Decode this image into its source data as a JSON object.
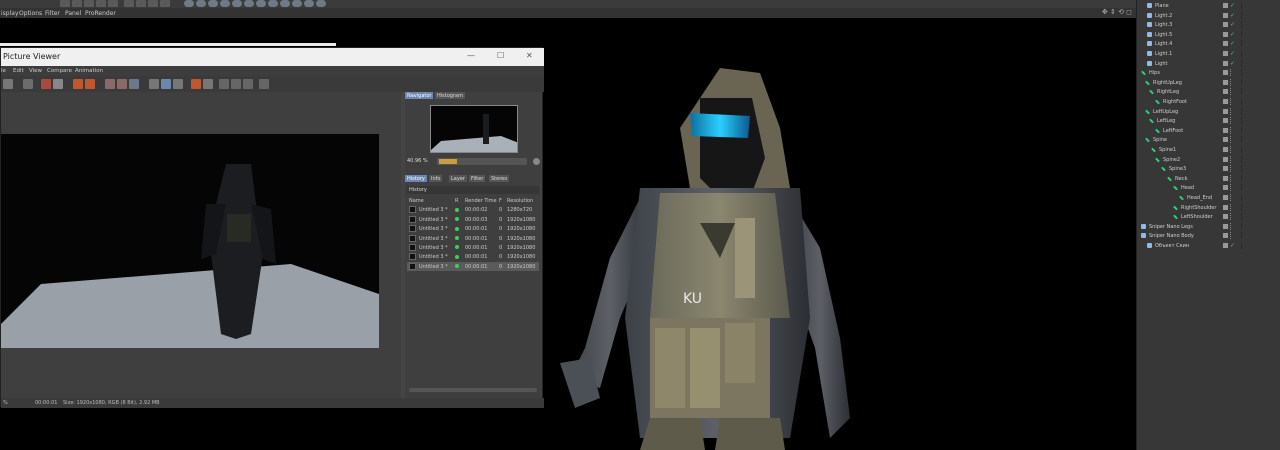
{
  "menu": {
    "items": [
      "isplay",
      "Options",
      "Filter",
      "Panel",
      "ProRender"
    ]
  },
  "picture_viewer": {
    "title": "Picture Viewer",
    "window_buttons": [
      "—",
      "☐",
      "✕"
    ],
    "menu": [
      "le",
      "Edit",
      "View",
      "Compare",
      "Animation"
    ],
    "side_tabs_top": [
      "Navigator",
      "Histogram"
    ],
    "zoom_value": "40.96 %",
    "side_tabs": [
      "History",
      "Info",
      "Layer",
      "Filter",
      "Stereo"
    ],
    "history_label": "History",
    "history_columns": [
      "Name",
      "R",
      "Render Time",
      "F",
      "Resolution"
    ],
    "history_rows": [
      {
        "name": "Untitled 3 *",
        "time": "00:00:02",
        "f": "0",
        "res": "1280x720"
      },
      {
        "name": "Untitled 3 *",
        "time": "00:00:03",
        "f": "0",
        "res": "1920x1080"
      },
      {
        "name": "Untitled 3 *",
        "time": "00:00:01",
        "f": "0",
        "res": "1920x1080"
      },
      {
        "name": "Untitled 3 *",
        "time": "00:00:01",
        "f": "0",
        "res": "1920x1080"
      },
      {
        "name": "Untitled 3 *",
        "time": "00:00:01",
        "f": "0",
        "res": "1920x1080"
      },
      {
        "name": "Untitled 3 *",
        "time": "00:00:01",
        "f": "0",
        "res": "1920x1080"
      },
      {
        "name": "Untitled 3 *",
        "time": "00:00:01",
        "f": "0",
        "res": "1920x1080"
      }
    ],
    "status": {
      "zoom": "%",
      "time": "00:00:01",
      "size": "Size: 1920x1080, RGB (8 Bit), 2.92 MB"
    }
  },
  "object_manager": {
    "rows": [
      {
        "name": "Plane",
        "kind": "obj"
      },
      {
        "name": "Light.2",
        "kind": "light"
      },
      {
        "name": "Light.3",
        "kind": "light"
      },
      {
        "name": "Light.5",
        "kind": "light"
      },
      {
        "name": "Light.4",
        "kind": "light"
      },
      {
        "name": "Light.1",
        "kind": "light"
      },
      {
        "name": "Light",
        "kind": "light"
      },
      {
        "name": "Hips",
        "kind": "bone"
      },
      {
        "name": "RightUpLeg",
        "kind": "bone"
      },
      {
        "name": "RightLeg",
        "kind": "bone"
      },
      {
        "name": "RightFoot",
        "kind": "bone"
      },
      {
        "name": "LeftUpLeg",
        "kind": "bone"
      },
      {
        "name": "LeftLeg",
        "kind": "bone"
      },
      {
        "name": "LeftFoot",
        "kind": "bone"
      },
      {
        "name": "Spine",
        "kind": "bone"
      },
      {
        "name": "Spine1",
        "kind": "bone"
      },
      {
        "name": "Spine2",
        "kind": "bone"
      },
      {
        "name": "Spine3",
        "kind": "bone"
      },
      {
        "name": "Neck",
        "kind": "bone"
      },
      {
        "name": "Head",
        "kind": "bone"
      },
      {
        "name": "Head_End",
        "kind": "bone"
      },
      {
        "name": "RightShoulder",
        "kind": "bone"
      },
      {
        "name": "LeftShoulder",
        "kind": "bone"
      },
      {
        "name": "Sniper Nano Legs",
        "kind": "mesh"
      },
      {
        "name": "Sniper Nano Body",
        "kind": "mesh"
      },
      {
        "name": "Объект Скин",
        "kind": "skin"
      }
    ]
  },
  "colors": {
    "accent": "#6b86b0",
    "check": "#3ecf5a",
    "bone": "#2fd07a"
  }
}
